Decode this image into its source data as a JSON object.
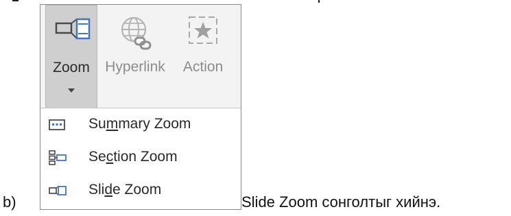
{
  "item_marker": "b)",
  "caption": "Slide Zoom сонголтыг хийнэ.",
  "ribbon": {
    "buttons": [
      {
        "label": "Zoom",
        "icon": "zoom-icon",
        "has_dropdown": true,
        "enabled": true
      },
      {
        "label": "Hyperlink",
        "icon": "hyperlink-icon",
        "enabled": false
      },
      {
        "label": "Action",
        "icon": "action-icon",
        "enabled": false
      }
    ]
  },
  "menu": {
    "items": [
      {
        "label_pre": "Su",
        "label_key": "m",
        "label_post": "mary Zoom",
        "icon": "summary-zoom-icon"
      },
      {
        "label_pre": "Se",
        "label_key": "c",
        "label_post": "tion Zoom",
        "icon": "section-zoom-icon"
      },
      {
        "label_pre": "Sli",
        "label_key": "d",
        "label_post": "e Zoom",
        "icon": "slide-zoom-icon"
      }
    ]
  },
  "colors": {
    "ribbon_bg": "#f3f3f3",
    "pressed_button_bg": "#cfcfcf",
    "disabled_text": "#8c8c8c",
    "icon_blue": "#4472c4"
  }
}
